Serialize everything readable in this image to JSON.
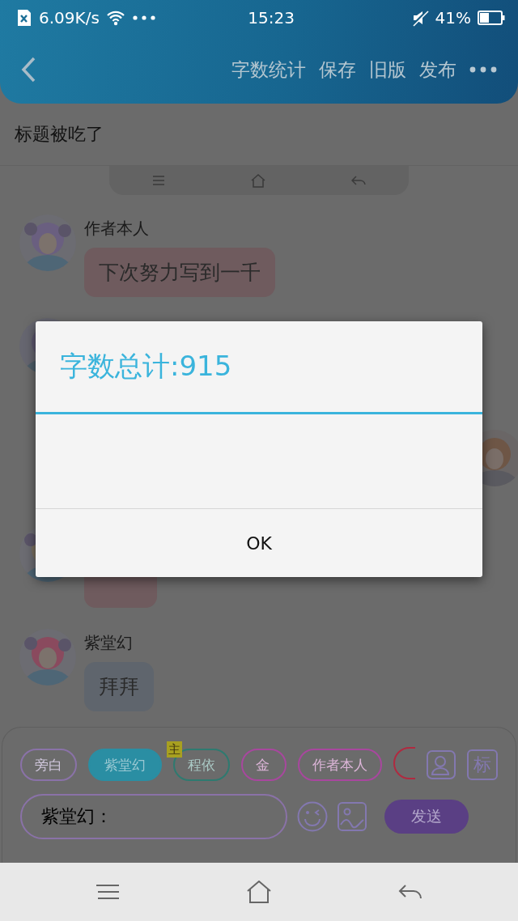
{
  "status_bar": {
    "speed": "6.09K/s",
    "time": "15:23",
    "battery": "41%"
  },
  "header": {
    "actions": [
      "字数统计",
      "保存",
      "旧版",
      "发布"
    ]
  },
  "title": "标题被吃了",
  "messages": [
    {
      "name": "作者本人",
      "text": "下次努力写到一千",
      "color": "#6f5b5e"
    },
    {
      "color": "#6f5b5e"
    },
    {
      "name": "紫堂幻",
      "text": "拜拜",
      "color": "#5f656d"
    }
  ],
  "chips": [
    {
      "label": "旁白",
      "color": "#8a72a8",
      "selected": false
    },
    {
      "label": "紫堂幻",
      "color": "#2a8ea3",
      "selected": true
    },
    {
      "label": "程依",
      "color": "#2e7a70",
      "selected": false,
      "badge": "主"
    },
    {
      "label": "金",
      "color": "#a8479e",
      "selected": false
    },
    {
      "label": "作者本人",
      "color": "#a8479e",
      "selected": false
    },
    {
      "color": "#b02a40",
      "selected": false
    }
  ],
  "tag_button": "标",
  "input": {
    "value": "紫堂幻："
  },
  "send": "发送",
  "dialog": {
    "title": "字数总计:915",
    "button": "OK"
  }
}
